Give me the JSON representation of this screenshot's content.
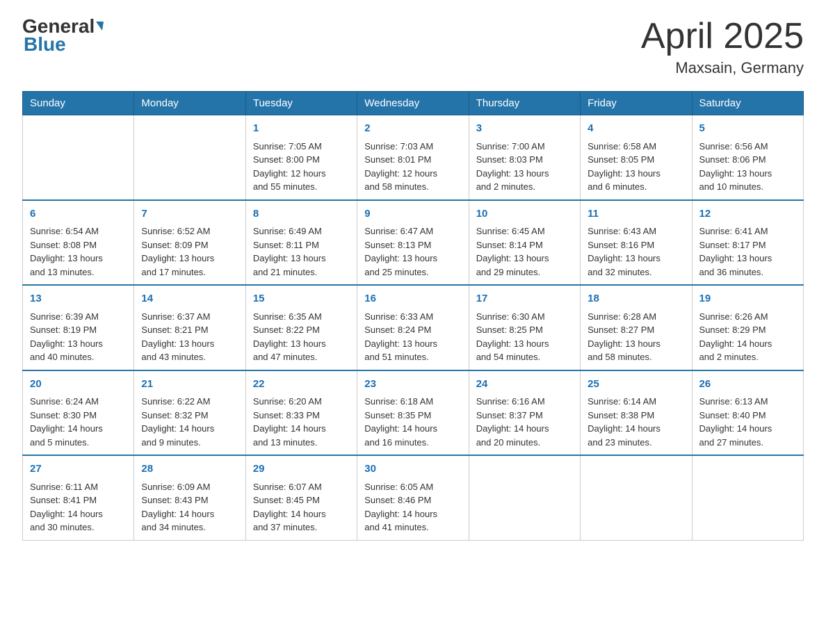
{
  "header": {
    "logo_general": "General",
    "logo_blue": "Blue",
    "title": "April 2025",
    "subtitle": "Maxsain, Germany"
  },
  "weekdays": [
    "Sunday",
    "Monday",
    "Tuesday",
    "Wednesday",
    "Thursday",
    "Friday",
    "Saturday"
  ],
  "weeks": [
    [
      {
        "day": "",
        "info": ""
      },
      {
        "day": "",
        "info": ""
      },
      {
        "day": "1",
        "info": "Sunrise: 7:05 AM\nSunset: 8:00 PM\nDaylight: 12 hours\nand 55 minutes."
      },
      {
        "day": "2",
        "info": "Sunrise: 7:03 AM\nSunset: 8:01 PM\nDaylight: 12 hours\nand 58 minutes."
      },
      {
        "day": "3",
        "info": "Sunrise: 7:00 AM\nSunset: 8:03 PM\nDaylight: 13 hours\nand 2 minutes."
      },
      {
        "day": "4",
        "info": "Sunrise: 6:58 AM\nSunset: 8:05 PM\nDaylight: 13 hours\nand 6 minutes."
      },
      {
        "day": "5",
        "info": "Sunrise: 6:56 AM\nSunset: 8:06 PM\nDaylight: 13 hours\nand 10 minutes."
      }
    ],
    [
      {
        "day": "6",
        "info": "Sunrise: 6:54 AM\nSunset: 8:08 PM\nDaylight: 13 hours\nand 13 minutes."
      },
      {
        "day": "7",
        "info": "Sunrise: 6:52 AM\nSunset: 8:09 PM\nDaylight: 13 hours\nand 17 minutes."
      },
      {
        "day": "8",
        "info": "Sunrise: 6:49 AM\nSunset: 8:11 PM\nDaylight: 13 hours\nand 21 minutes."
      },
      {
        "day": "9",
        "info": "Sunrise: 6:47 AM\nSunset: 8:13 PM\nDaylight: 13 hours\nand 25 minutes."
      },
      {
        "day": "10",
        "info": "Sunrise: 6:45 AM\nSunset: 8:14 PM\nDaylight: 13 hours\nand 29 minutes."
      },
      {
        "day": "11",
        "info": "Sunrise: 6:43 AM\nSunset: 8:16 PM\nDaylight: 13 hours\nand 32 minutes."
      },
      {
        "day": "12",
        "info": "Sunrise: 6:41 AM\nSunset: 8:17 PM\nDaylight: 13 hours\nand 36 minutes."
      }
    ],
    [
      {
        "day": "13",
        "info": "Sunrise: 6:39 AM\nSunset: 8:19 PM\nDaylight: 13 hours\nand 40 minutes."
      },
      {
        "day": "14",
        "info": "Sunrise: 6:37 AM\nSunset: 8:21 PM\nDaylight: 13 hours\nand 43 minutes."
      },
      {
        "day": "15",
        "info": "Sunrise: 6:35 AM\nSunset: 8:22 PM\nDaylight: 13 hours\nand 47 minutes."
      },
      {
        "day": "16",
        "info": "Sunrise: 6:33 AM\nSunset: 8:24 PM\nDaylight: 13 hours\nand 51 minutes."
      },
      {
        "day": "17",
        "info": "Sunrise: 6:30 AM\nSunset: 8:25 PM\nDaylight: 13 hours\nand 54 minutes."
      },
      {
        "day": "18",
        "info": "Sunrise: 6:28 AM\nSunset: 8:27 PM\nDaylight: 13 hours\nand 58 minutes."
      },
      {
        "day": "19",
        "info": "Sunrise: 6:26 AM\nSunset: 8:29 PM\nDaylight: 14 hours\nand 2 minutes."
      }
    ],
    [
      {
        "day": "20",
        "info": "Sunrise: 6:24 AM\nSunset: 8:30 PM\nDaylight: 14 hours\nand 5 minutes."
      },
      {
        "day": "21",
        "info": "Sunrise: 6:22 AM\nSunset: 8:32 PM\nDaylight: 14 hours\nand 9 minutes."
      },
      {
        "day": "22",
        "info": "Sunrise: 6:20 AM\nSunset: 8:33 PM\nDaylight: 14 hours\nand 13 minutes."
      },
      {
        "day": "23",
        "info": "Sunrise: 6:18 AM\nSunset: 8:35 PM\nDaylight: 14 hours\nand 16 minutes."
      },
      {
        "day": "24",
        "info": "Sunrise: 6:16 AM\nSunset: 8:37 PM\nDaylight: 14 hours\nand 20 minutes."
      },
      {
        "day": "25",
        "info": "Sunrise: 6:14 AM\nSunset: 8:38 PM\nDaylight: 14 hours\nand 23 minutes."
      },
      {
        "day": "26",
        "info": "Sunrise: 6:13 AM\nSunset: 8:40 PM\nDaylight: 14 hours\nand 27 minutes."
      }
    ],
    [
      {
        "day": "27",
        "info": "Sunrise: 6:11 AM\nSunset: 8:41 PM\nDaylight: 14 hours\nand 30 minutes."
      },
      {
        "day": "28",
        "info": "Sunrise: 6:09 AM\nSunset: 8:43 PM\nDaylight: 14 hours\nand 34 minutes."
      },
      {
        "day": "29",
        "info": "Sunrise: 6:07 AM\nSunset: 8:45 PM\nDaylight: 14 hours\nand 37 minutes."
      },
      {
        "day": "30",
        "info": "Sunrise: 6:05 AM\nSunset: 8:46 PM\nDaylight: 14 hours\nand 41 minutes."
      },
      {
        "day": "",
        "info": ""
      },
      {
        "day": "",
        "info": ""
      },
      {
        "day": "",
        "info": ""
      }
    ]
  ]
}
